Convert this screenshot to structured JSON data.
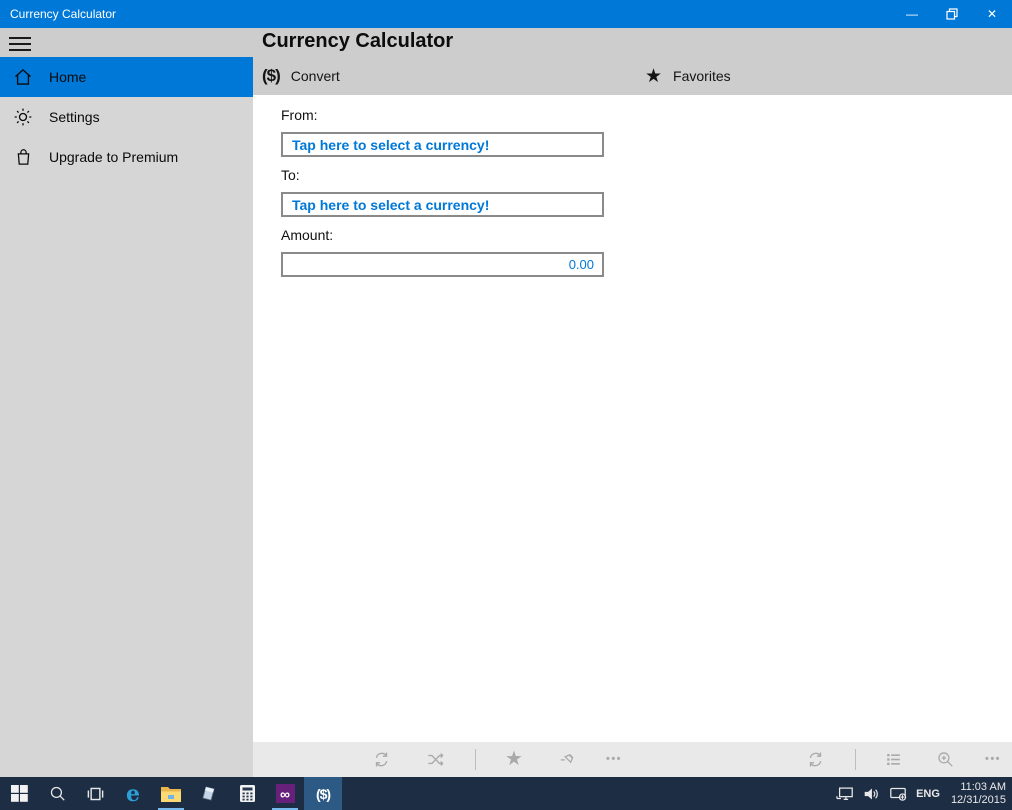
{
  "titlebar": {
    "title": "Currency Calculator",
    "minimize_glyph": "—",
    "close_glyph": "✕"
  },
  "header": {
    "title": "Currency Calculator"
  },
  "sidebar": {
    "items": [
      {
        "label": "Home",
        "icon": "home-icon",
        "active": true
      },
      {
        "label": "Settings",
        "icon": "gear-icon",
        "active": false
      },
      {
        "label": "Upgrade to Premium",
        "icon": "shopping-bag-icon",
        "active": false
      }
    ]
  },
  "tabs": {
    "convert": {
      "label": "Convert",
      "icon_glyph": "($)"
    },
    "favorites": {
      "label": "Favorites",
      "icon_glyph": "★"
    }
  },
  "form": {
    "from_label": "From:",
    "from_value": "Tap here to select a currency!",
    "to_label": "To:",
    "to_value": "Tap here to select a currency!",
    "amount_label": "Amount:",
    "amount_value": "0.00"
  },
  "command_bar": {
    "star_glyph": "★",
    "more_glyph": "•••"
  },
  "taskbar": {
    "currency_app_glyph": "($)",
    "edge_glyph": "e",
    "vs_glyph": "∞",
    "language": "ENG",
    "time": "11:03 AM",
    "date": "12/31/2015"
  },
  "colors": {
    "accent": "#0078d7",
    "titlebar": "#0078d7",
    "header_band": "#cdcdcd",
    "sidebar": "#d6d6d6",
    "command_bar": "#e9e9e9",
    "disabled_icon": "#a9a9a9",
    "input_text": "#0078d7",
    "taskbar": "#1d2d44",
    "taskbar_active": "#2c5a85"
  }
}
